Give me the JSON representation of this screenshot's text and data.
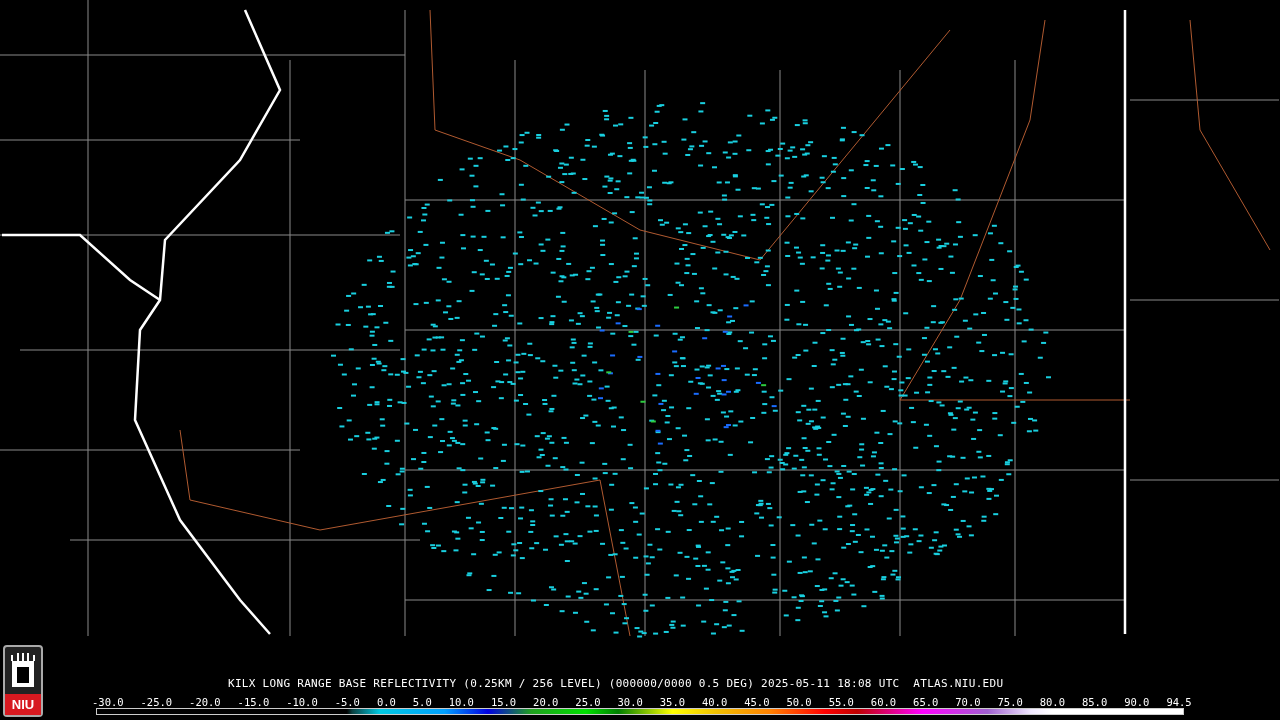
{
  "logo": {
    "text": "NIU"
  },
  "caption": {
    "text": "KILX LONG RANGE BASE REFLECTIVITY (0.25KM / 256 LEVEL) (000000/0000 0.5 DEG) 2025-05-11 18:08 UTC  ATLAS.NIU.EDU"
  },
  "color_scale": {
    "labels": [
      "-30.0",
      "-25.0",
      "-20.0",
      "-15.0",
      "-10.0",
      "-5.0",
      "0.0",
      "5.0",
      "10.0",
      "15.0",
      "20.0",
      "25.0",
      "30.0",
      "35.0",
      "40.0",
      "45.0",
      "50.0",
      "55.0",
      "60.0",
      "65.0",
      "70.0",
      "75.0",
      "80.0",
      "85.0",
      "90.0",
      "94.5"
    ]
  }
}
